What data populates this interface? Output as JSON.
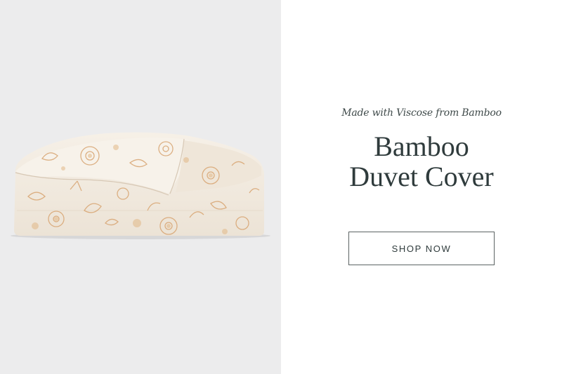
{
  "promo": {
    "eyebrow": "Made with Viscose from Bamboo",
    "title_line1": "Bamboo",
    "title_line2": "Duvet Cover",
    "cta_label": "SHOP NOW"
  },
  "image": {
    "subject": "folded-floral-duvet-cover",
    "palette": {
      "fabric": "#f3ece2",
      "print": "#d9a877",
      "backdrop": "#ececed"
    }
  }
}
